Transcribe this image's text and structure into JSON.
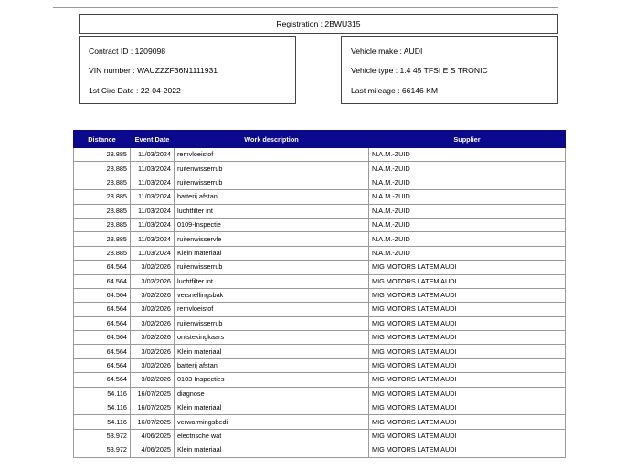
{
  "header": {
    "registration_label": "Registration : 2BWU315"
  },
  "contract": {
    "contract_id": "Contract ID : 1209098",
    "vin": "VIN number : WAUZZZF36N1111931",
    "first_circ_date": "1st Circ Date : 22-04-2022"
  },
  "vehicle": {
    "make": "Vehicle make : AUDI",
    "type": "Vehicle type : 1.4 45 TFSI E S TRONIC",
    "last_mileage": "Last mileage : 66146 KM"
  },
  "table": {
    "columns": [
      "Distance",
      "Event Date",
      "Work description",
      "Supplier"
    ],
    "rows": [
      [
        "28.885",
        "11/03/2024",
        "remvloeistof",
        "N.A.M.-ZUID"
      ],
      [
        "28.885",
        "11/03/2024",
        "ruitenwisserrub",
        "N.A.M.-ZUID"
      ],
      [
        "28.885",
        "11/03/2024",
        "ruitenwisserrub",
        "N.A.M.-ZUID"
      ],
      [
        "28.885",
        "11/03/2024",
        "batterij afstan",
        "N.A.M.-ZUID"
      ],
      [
        "28.885",
        "11/03/2024",
        "luchtfilter int",
        "N.A.M.-ZUID"
      ],
      [
        "28.885",
        "11/03/2024",
        "0109-Inspectie",
        "N.A.M.-ZUID"
      ],
      [
        "28.885",
        "11/03/2024",
        "ruitenwisservle",
        "N.A.M.-ZUID"
      ],
      [
        "28.885",
        "11/03/2024",
        "Klein materiaal",
        "N.A.M.-ZUID"
      ],
      [
        "64.564",
        "3/02/2026",
        "ruitenwisserrub",
        "MIG MOTORS LATEM AUDI"
      ],
      [
        "64.564",
        "3/02/2026",
        "luchtfilter int",
        "MIG MOTORS LATEM AUDI"
      ],
      [
        "64.564",
        "3/02/2026",
        "versnellingsbak",
        "MIG MOTORS LATEM AUDI"
      ],
      [
        "64.564",
        "3/02/2026",
        "remvloeistof",
        "MIG MOTORS LATEM AUDI"
      ],
      [
        "64.564",
        "3/02/2026",
        "ruitenwisserrub",
        "MIG MOTORS LATEM AUDI"
      ],
      [
        "64.564",
        "3/02/2026",
        "ontstekingkaars",
        "MIG MOTORS LATEM AUDI"
      ],
      [
        "64.564",
        "3/02/2026",
        "Klein materiaal",
        "MIG MOTORS LATEM AUDI"
      ],
      [
        "64.564",
        "3/02/2026",
        "batterij afstan",
        "MIG MOTORS LATEM AUDI"
      ],
      [
        "64.564",
        "3/02/2026",
        "0103-Inspecties",
        "MIG MOTORS LATEM AUDI"
      ],
      [
        "54.116",
        "16/07/2025",
        "diagnose",
        "MIG MOTORS LATEM AUDI"
      ],
      [
        "54.116",
        "16/07/2025",
        "Klein materiaal",
        "MIG MOTORS LATEM AUDI"
      ],
      [
        "54.116",
        "16/07/2025",
        "verwarmingsbedi",
        "MIG MOTORS LATEM AUDI"
      ],
      [
        "53.972",
        "4/06/2025",
        "electrische wat",
        "MIG MOTORS LATEM AUDI"
      ],
      [
        "53.972",
        "4/06/2025",
        "Klein materiaal",
        "MIG MOTORS LATEM AUDI"
      ]
    ]
  },
  "colors": {
    "header_bg": "#0b0a8e",
    "header_text": "#ffffff",
    "grid": "#9a9a9a"
  }
}
